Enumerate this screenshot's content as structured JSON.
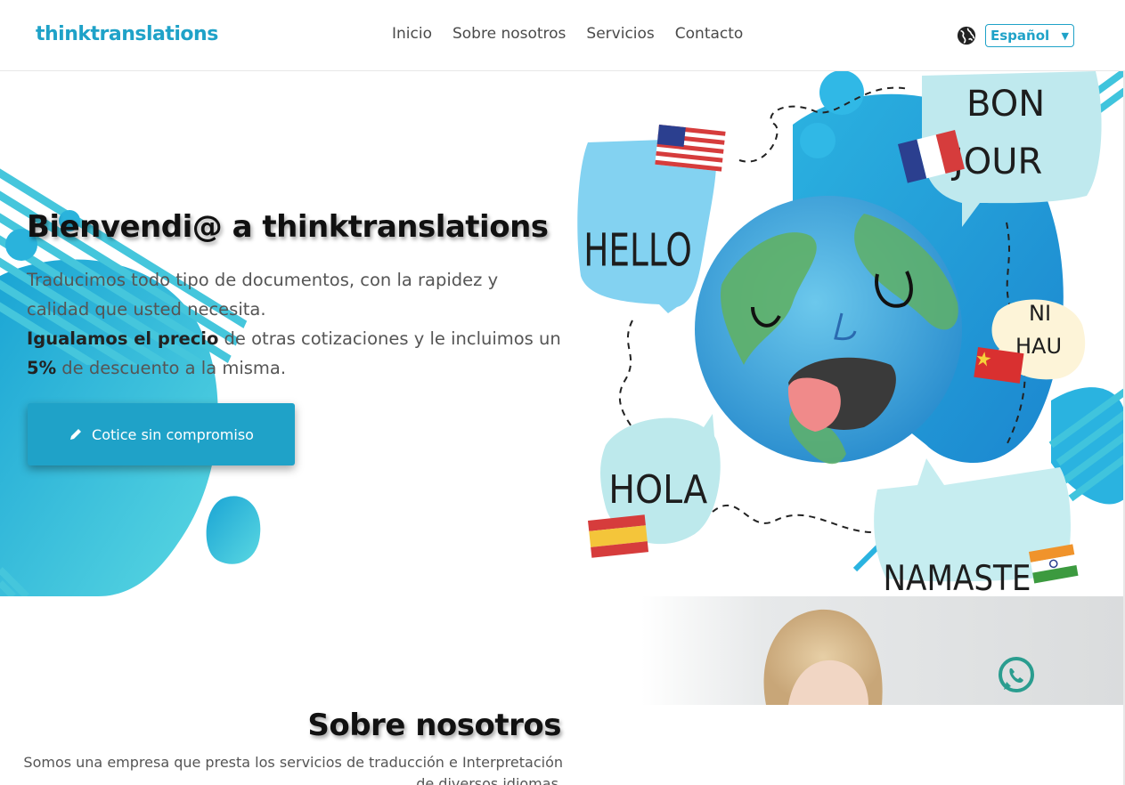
{
  "brand": {
    "name": "thinktranslations"
  },
  "nav": {
    "links": [
      "Inicio",
      "Sobre nosotros",
      "Servicios",
      "Contacto"
    ],
    "language": {
      "selected": "Español",
      "icon": "globe-icon"
    }
  },
  "hero": {
    "title": "Bienvendi@ a thinktranslations",
    "line1": "Traducimos todo tipo de documentos, con la rapidez y calidad que usted necesita.",
    "bold_price": "Igualamos el precio",
    "line2": " de otras cotizaciones y le incluimos un ",
    "bold_discount": "5%",
    "line3": " de descuento a la misma.",
    "cta_label": "Cotice sin compromiso",
    "cta_icon": "pencil-icon",
    "art_words": [
      "HELLO",
      "BON",
      "JOUR",
      "NI",
      "HAU",
      "HOLA",
      "NAMASTE"
    ]
  },
  "about": {
    "title": "Sobre nosotros",
    "text": "Somos una empresa que presta los servicios de traducción e Interpretación de diversos idiomas."
  },
  "floating": {
    "whatsapp_icon": "whatsapp-icon"
  },
  "colors": {
    "accent": "#1fa2c8",
    "light_accent": "#4fd1e0"
  }
}
